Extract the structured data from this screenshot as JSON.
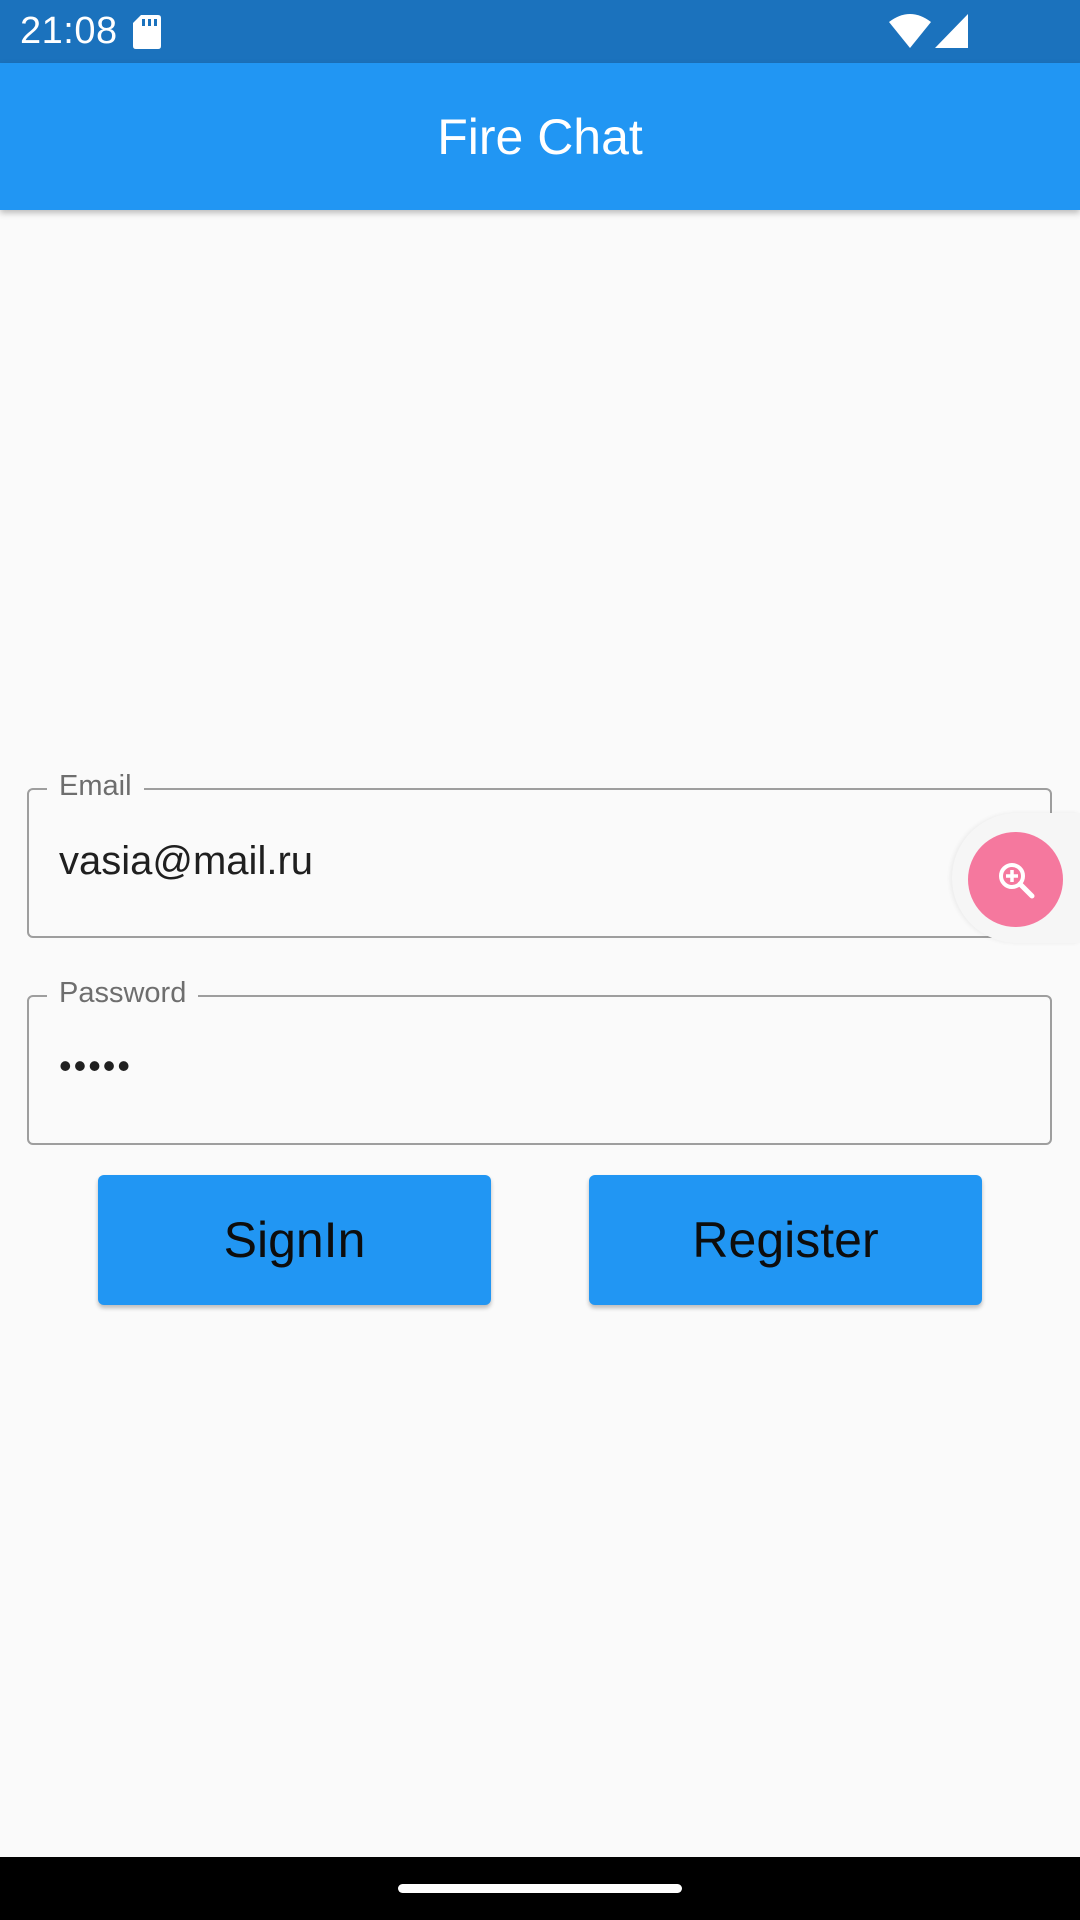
{
  "status_bar": {
    "time": "21:08",
    "icons": [
      "sd-card-icon",
      "wifi-icon",
      "cell-signal-icon"
    ]
  },
  "app_bar": {
    "title": "Fire Chat",
    "color": "#2196f3"
  },
  "form": {
    "email": {
      "label": "Email",
      "value": "vasia@mail.ru"
    },
    "password": {
      "label": "Password",
      "value": "•••••"
    }
  },
  "buttons": {
    "signin_label": "SignIn",
    "register_label": "Register",
    "color": "#2196f3"
  },
  "overlay": {
    "icon": "zoom-in-icon",
    "color": "#f5789e"
  }
}
